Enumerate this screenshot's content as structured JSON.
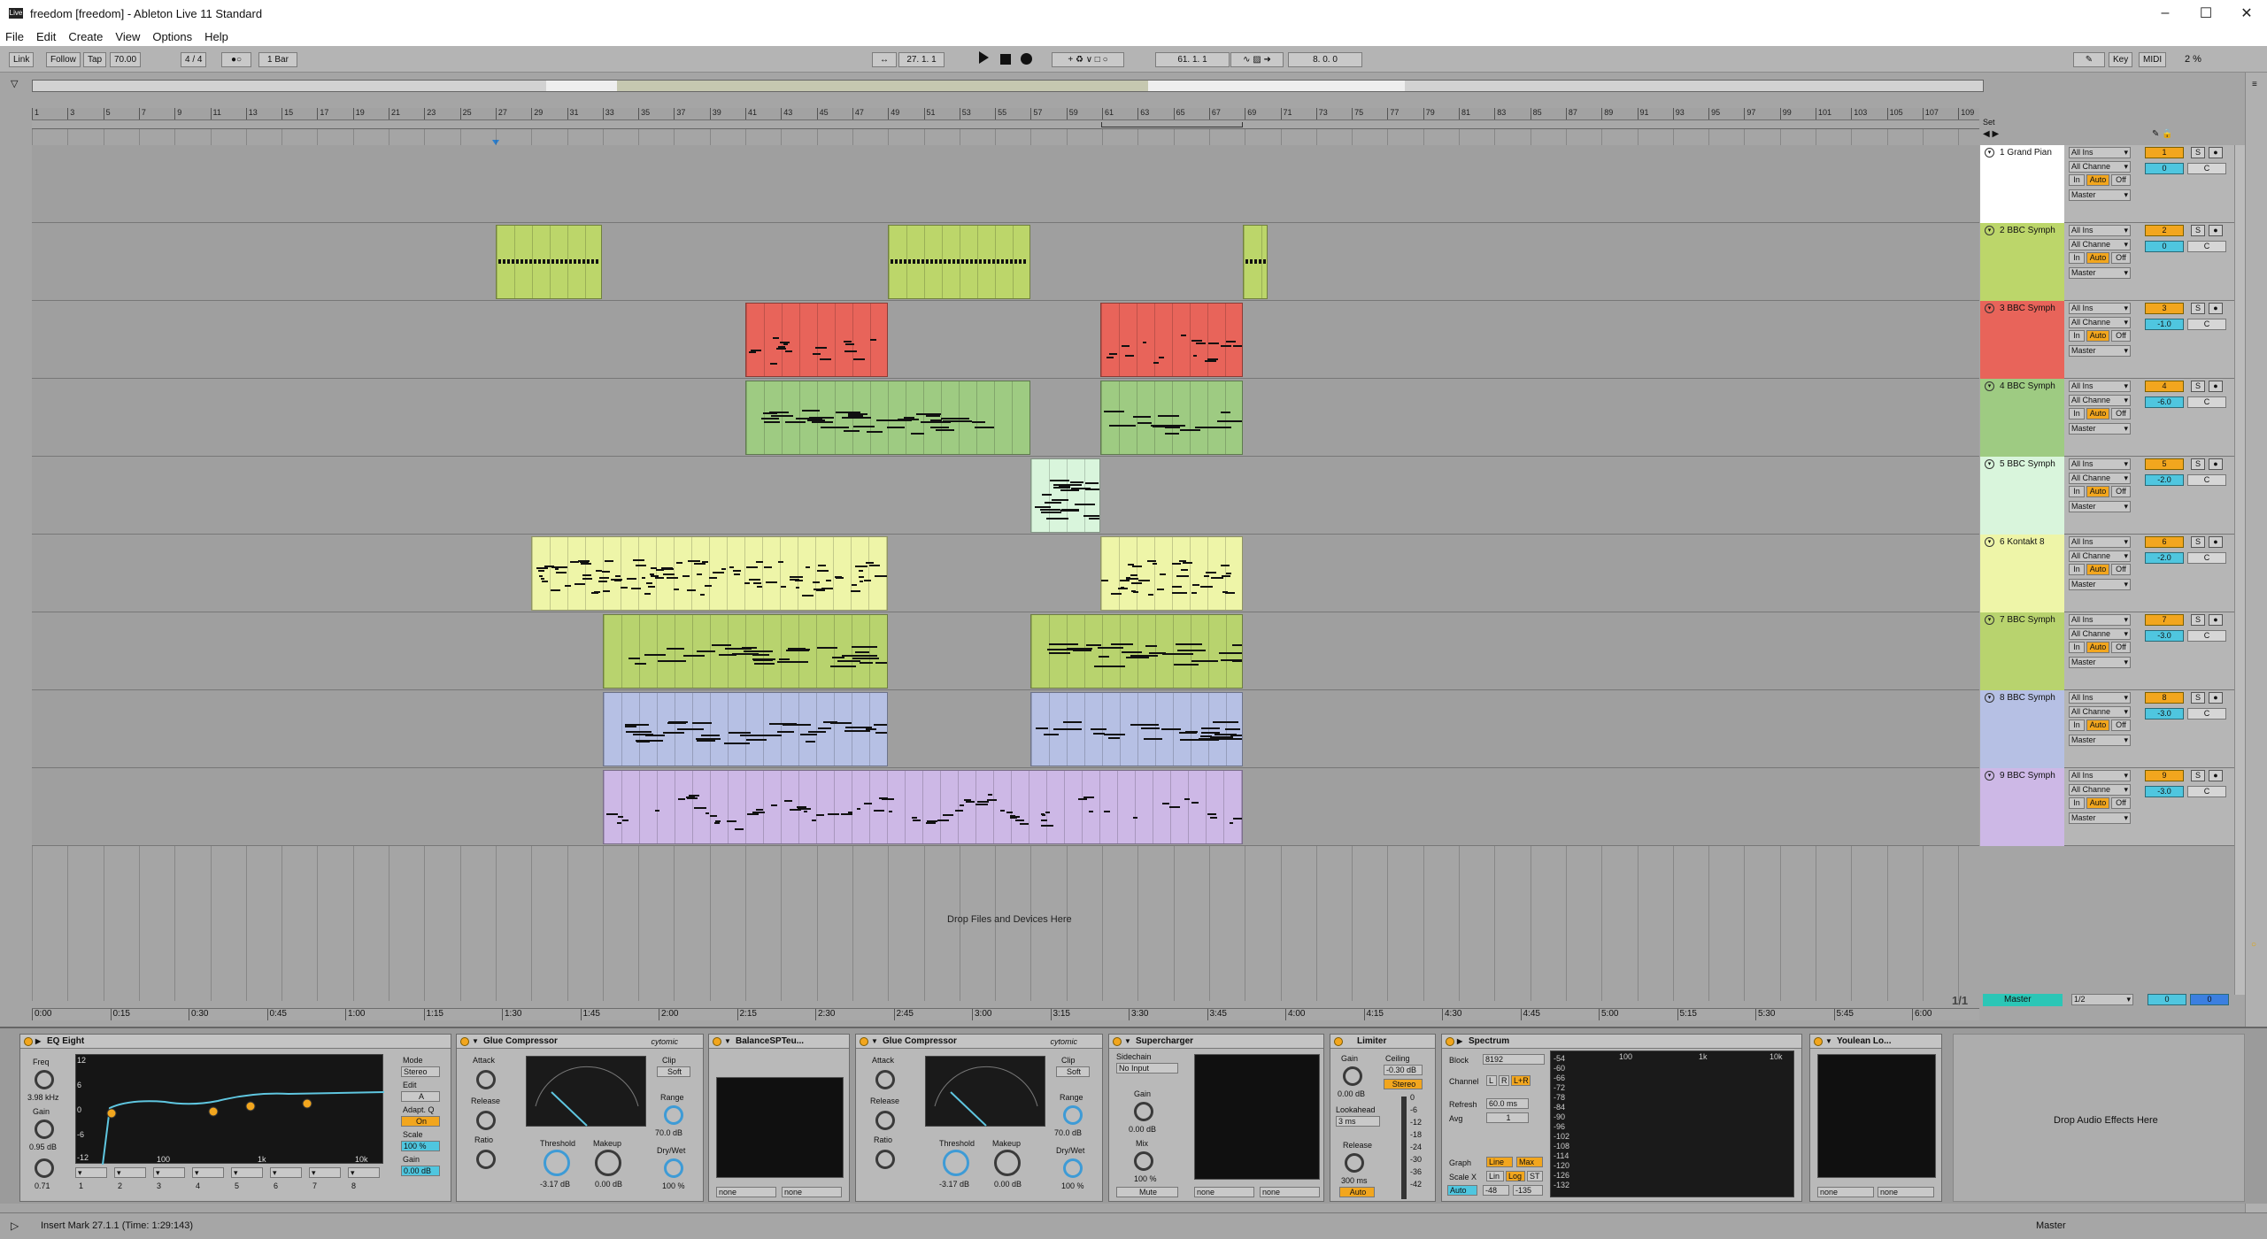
{
  "window": {
    "title": "freedom  [freedom] - Ableton Live 11 Standard",
    "app_icon_text": "Live"
  },
  "menu": [
    "File",
    "Edit",
    "Create",
    "View",
    "Options",
    "Help"
  ],
  "control_bar": {
    "link": "Link",
    "follow": "Follow",
    "tap": "Tap",
    "tempo": "70.00",
    "time_sig": "4 / 4",
    "quantize": "1 Bar",
    "arrangement_position": "27.  1.  1",
    "loop_start": "61.  1.  1",
    "loop_length": "8.  0.  0",
    "key": "Key",
    "midi": "MIDI",
    "cpu": "2 %"
  },
  "ruler_bars": [
    "1",
    "3",
    "5",
    "7",
    "9",
    "11",
    "13",
    "15",
    "17",
    "19",
    "21",
    "23",
    "25",
    "27",
    "29",
    "31",
    "33",
    "35",
    "37",
    "39",
    "41",
    "43",
    "45",
    "47",
    "49",
    "51",
    "53",
    "55",
    "57",
    "59",
    "61",
    "63",
    "65",
    "67",
    "69",
    "71",
    "73",
    "75",
    "77",
    "79",
    "81",
    "83",
    "85",
    "87",
    "89",
    "91",
    "93",
    "95",
    "97",
    "99",
    "101",
    "103",
    "105",
    "107",
    "109"
  ],
  "time_ticks": [
    "0:00",
    "0:15",
    "0:30",
    "0:45",
    "1:00",
    "1:15",
    "1:30",
    "1:45",
    "2:00",
    "2:15",
    "2:30",
    "2:45",
    "3:00",
    "3:15",
    "3:30",
    "3:45",
    "4:00",
    "4:15",
    "4:30",
    "4:45",
    "5:00",
    "5:15",
    "5:30",
    "5:45",
    "6:00"
  ],
  "tracks": [
    {
      "name": "1 Grand Pian",
      "color": "#ffffff",
      "num": "1",
      "vol": "0",
      "pan": "C"
    },
    {
      "name": "2 BBC Symph",
      "color": "#bcd66a",
      "num": "2",
      "vol": "0",
      "pan": "C"
    },
    {
      "name": "3 BBC Symph",
      "color": "#e8645a",
      "num": "3",
      "vol": "-1.0",
      "pan": "C"
    },
    {
      "name": "4 BBC Symph",
      "color": "#9ecb82",
      "num": "4",
      "vol": "-6.0",
      "pan": "C"
    },
    {
      "name": "5 BBC Symph",
      "color": "#d9f5dc",
      "num": "5",
      "vol": "-2.0",
      "pan": "C"
    },
    {
      "name": "6 Kontakt 8",
      "color": "#eef5a8",
      "num": "6",
      "vol": "-2.0",
      "pan": "C"
    },
    {
      "name": "7 BBC Symph",
      "color": "#b8d36e",
      "num": "7",
      "vol": "-3.0",
      "pan": "C"
    },
    {
      "name": "8 BBC Symph",
      "color": "#b6c0e4",
      "num": "8",
      "vol": "-3.0",
      "pan": "C"
    },
    {
      "name": "9 BBC Symph",
      "color": "#cdb8e6",
      "num": "9",
      "vol": "-3.0",
      "pan": "C"
    }
  ],
  "mixer_io": {
    "input": "All Ins",
    "channel": "All Channe",
    "in": "In",
    "auto": "Auto",
    "off": "Off",
    "output": "Master",
    "solo": "S"
  },
  "drop_files": "Drop Files and Devices Here",
  "page_count": "1/1",
  "master": {
    "name": "Master",
    "io": "1/2",
    "vol": "0",
    "pan": "0"
  },
  "set_label": "Set",
  "devices": {
    "eq": {
      "name": "EQ Eight",
      "freq_label": "Freq",
      "freq": "3.98 kHz",
      "gain_label": "Gain",
      "gain": "0.95 dB",
      "q": "0.71",
      "mode_label": "Mode",
      "mode": "Stereo",
      "edit": "Edit",
      "edit_val": "A",
      "adapt": "Adapt. Q",
      "adapt_val": "On",
      "scale_label": "Scale",
      "scale": "100 %",
      "out_gain_label": "Gain",
      "out_gain": "0.00 dB",
      "axis": [
        "12",
        "6",
        "0",
        "-6",
        "-12"
      ],
      "freq_axis": [
        "100",
        "1k",
        "10k"
      ],
      "bands": [
        "1",
        "2",
        "3",
        "4",
        "5",
        "6",
        "7",
        "8"
      ]
    },
    "glue1": {
      "name": "Glue Compressor",
      "vendor": "cytomic",
      "attack": "Attack",
      "release": "Release",
      "ratio": "Ratio",
      "threshold": "Threshold",
      "threshold_val": "-3.17 dB",
      "makeup": "Makeup",
      "makeup_val": "0.00 dB",
      "clip": "Clip",
      "soft": "Soft",
      "range": "Range",
      "range_val": "70.0 dB",
      "drywet": "Dry/Wet",
      "drywet_val": "100 %"
    },
    "balance": {
      "name": "BalanceSPTeu...",
      "none1": "none",
      "none2": "none"
    },
    "glue2": {
      "name": "Glue Compressor",
      "vendor": "cytomic",
      "attack": "Attack",
      "release": "Release",
      "ratio": "Ratio",
      "threshold": "Threshold",
      "threshold_val": "-3.17 dB",
      "makeup": "Makeup",
      "makeup_val": "0.00 dB",
      "clip": "Clip",
      "soft": "Soft",
      "range": "Range",
      "range_val": "70.0 dB",
      "drywet": "Dry/Wet",
      "drywet_val": "100 %"
    },
    "supercharger": {
      "name": "Supercharger",
      "sidechain": "Sidechain",
      "no_input": "No Input",
      "gain": "Gain",
      "gain_val": "0.00 dB",
      "mix": "Mix",
      "mix_val": "100 %",
      "mute": "Mute",
      "none1": "none",
      "none2": "none"
    },
    "limiter": {
      "name": "Limiter",
      "gain": "Gain",
      "gain_val": "0.00 dB",
      "ceiling": "Ceiling",
      "ceiling_val": "-0.30 dB",
      "stereo": "Stereo",
      "lookahead": "Lookahead",
      "lookahead_val": "3 ms",
      "release": "Release",
      "release_val": "300 ms",
      "auto": "Auto",
      "meter": [
        "0",
        "-6",
        "-12",
        "-18",
        "-24",
        "-30",
        "-36",
        "-42"
      ]
    },
    "spectrum": {
      "name": "Spectrum",
      "block": "Block",
      "block_val": "8192",
      "channel": "Channel",
      "ch_l": "L",
      "ch_r": "R",
      "ch_lr": "L+R",
      "refresh": "Refresh",
      "refresh_val": "60.0 ms",
      "avg": "Avg",
      "avg_val": "1",
      "graph": "Graph",
      "line": "Line",
      "max": "Max",
      "scalex": "Scale X",
      "lin": "Lin",
      "log": "Log",
      "st": "ST",
      "auto": "Auto",
      "min1": "-48",
      "min2": "-135",
      "db_axis": [
        "-54",
        "-60",
        "-66",
        "-72",
        "-78",
        "-84",
        "-90",
        "-96",
        "-102",
        "-108",
        "-114",
        "-120",
        "-126",
        "-132"
      ],
      "freq_axis": [
        "100",
        "1k",
        "10k"
      ]
    },
    "youlean": {
      "name": "Youlean Lo...",
      "none1": "none",
      "none2": "none"
    },
    "drop_fx": "Drop Audio Effects Here"
  },
  "status": {
    "text": "Insert Mark 27.1.1 (Time: 1:29:143)",
    "master": "Master"
  }
}
